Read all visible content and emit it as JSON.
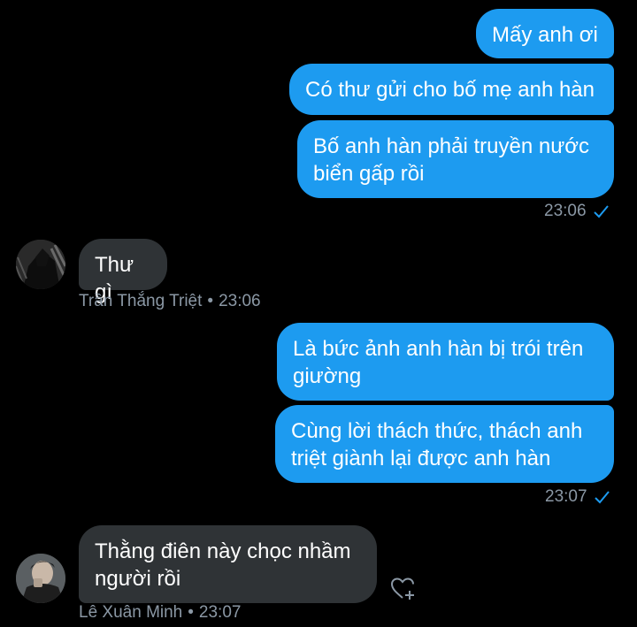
{
  "conversation": {
    "messages": [
      {
        "text": "Mấy anh ơi",
        "direction": "outgoing"
      },
      {
        "text": "Có thư gửi cho bố mẹ anh hàn",
        "direction": "outgoing"
      },
      {
        "text": "Bố anh hàn phải truyền nước\nbiển gấp rồi",
        "direction": "outgoing"
      },
      {
        "time": "23:06",
        "status_icon": "check-icon"
      },
      {
        "text": "Thư gì",
        "direction": "incoming",
        "sender": "Trần Thắng Triệt",
        "time": "23:06"
      },
      {
        "text": "Là bức ảnh anh hàn bị trói trên\ngiường",
        "direction": "outgoing"
      },
      {
        "text": "Cùng lời thách thức, thách anh\ntriệt giành lại được anh hàn",
        "direction": "outgoing"
      },
      {
        "time": "23:07",
        "status_icon": "check-icon"
      },
      {
        "text": "Thằng điên này chọc nhầm\nngười rồi",
        "direction": "incoming",
        "sender": "Lê Xuân Minh",
        "time": "23:07"
      }
    ],
    "meta_separator": "•"
  },
  "colors": {
    "background": "#000000",
    "outgoing_bubble": "#1d9bf0",
    "incoming_bubble": "#2f3336",
    "meta_text": "#8b98a5",
    "check": "#1d9bf0"
  },
  "icons": {
    "read_receipt": "check-icon",
    "reaction": "heart-plus-icon"
  }
}
